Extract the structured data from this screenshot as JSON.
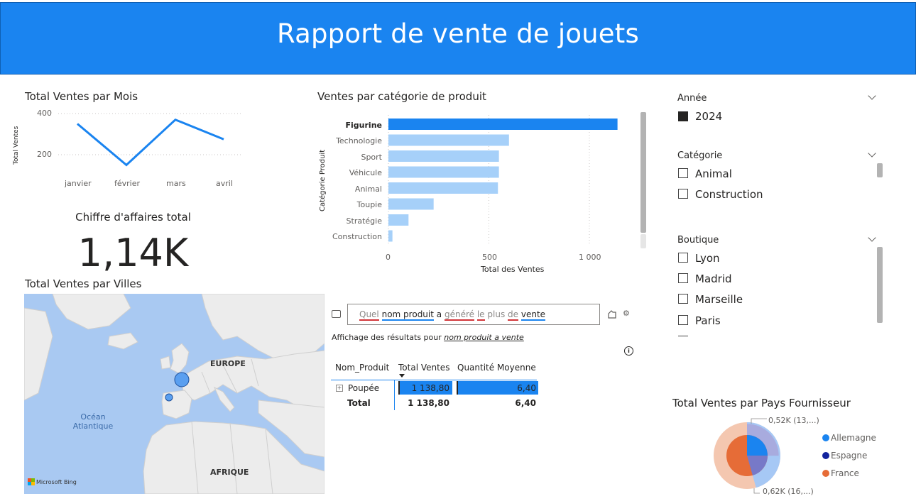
{
  "report": {
    "title": "Rapport de vente de jouets"
  },
  "line_chart": {
    "title": "Total Ventes par Mois",
    "ylabel": "Total Ventes",
    "yticks": [
      "400",
      "200"
    ],
    "months": [
      "janvier",
      "février",
      "mars",
      "avril"
    ]
  },
  "kpi": {
    "label": "Chiffre d'affaires total",
    "value": "1,14K"
  },
  "bar_chart": {
    "title": "Ventes par catégorie de produit",
    "ylabel": "Catégorie Produit",
    "xlabel": "Total des Ventes",
    "xticks": [
      "0",
      "500",
      "1 000"
    ]
  },
  "map": {
    "title": "Total Ventes par Villes",
    "labels": {
      "europe": "EUROPE",
      "ocean": "Océan\nAtlantique",
      "afrique": "AFRIQUE"
    },
    "attribution": "Microsoft Bing"
  },
  "qna": {
    "words": [
      "Quel",
      "nom produit",
      "a",
      "généré",
      "le",
      "plus",
      "de",
      "vente"
    ],
    "results_prefix": "Affichage des résultats pour ",
    "results_query": "nom produit a vente"
  },
  "table": {
    "headers": [
      "Nom_Produit",
      "Total Ventes",
      "Quantité Moyenne"
    ],
    "rows": [
      {
        "name": "Poupée",
        "total": "1 138,80",
        "qty": "6,40"
      }
    ],
    "total_row": {
      "label": "Total",
      "total": "1 138,80",
      "qty": "6,40"
    }
  },
  "slicers": {
    "annee": {
      "title": "Année",
      "items": [
        {
          "label": "2024",
          "checked": true
        }
      ]
    },
    "categorie": {
      "title": "Catégorie",
      "items": [
        {
          "label": "Animal",
          "checked": false
        },
        {
          "label": "Construction",
          "checked": false
        }
      ]
    },
    "boutique": {
      "title": "Boutique",
      "items": [
        {
          "label": "Lyon",
          "checked": false
        },
        {
          "label": "Madrid",
          "checked": false
        },
        {
          "label": "Marseille",
          "checked": false
        },
        {
          "label": "Paris",
          "checked": false
        }
      ]
    }
  },
  "pie": {
    "title": "Total Ventes par Pays Fournisseur",
    "callout_top": "0,52K (13,...)",
    "callout_bottom": "0,62K (16,...)",
    "legend": [
      {
        "label": "Allemagne",
        "color": "#1a84f0"
      },
      {
        "label": "Espagne",
        "color": "#12239e"
      },
      {
        "label": "France",
        "color": "#e66c37"
      }
    ]
  },
  "chart_data": [
    {
      "type": "line",
      "title": "Total Ventes par Mois",
      "xlabel": "",
      "ylabel": "Total Ventes",
      "categories": [
        "janvier",
        "février",
        "mars",
        "avril"
      ],
      "values": [
        350,
        150,
        370,
        275
      ],
      "ylim": [
        150,
        400
      ],
      "grid": true,
      "color": "#1a84f0"
    },
    {
      "type": "bar",
      "orientation": "horizontal",
      "title": "Ventes par catégorie de produit",
      "xlabel": "Total des Ventes",
      "ylabel": "Catégorie Produit",
      "categories": [
        "Figurine",
        "Technologie",
        "Sport",
        "Véhicule",
        "Animal",
        "Toupie",
        "Stratégie",
        "Construction"
      ],
      "values": [
        1140,
        600,
        550,
        550,
        545,
        225,
        100,
        20
      ],
      "xlim": [
        0,
        1260
      ],
      "highlight": "Figurine",
      "highlight_color": "#1a84f0",
      "color": "#a6d0f9"
    },
    {
      "type": "pie",
      "title": "Total Ventes par Pays Fournisseur",
      "series": [
        {
          "name": "Allemagne",
          "value": 0.52
        },
        {
          "name": "France",
          "value": 0.62
        }
      ],
      "legend": [
        "Allemagne",
        "Espagne",
        "France"
      ],
      "legend_position": "right"
    }
  ]
}
